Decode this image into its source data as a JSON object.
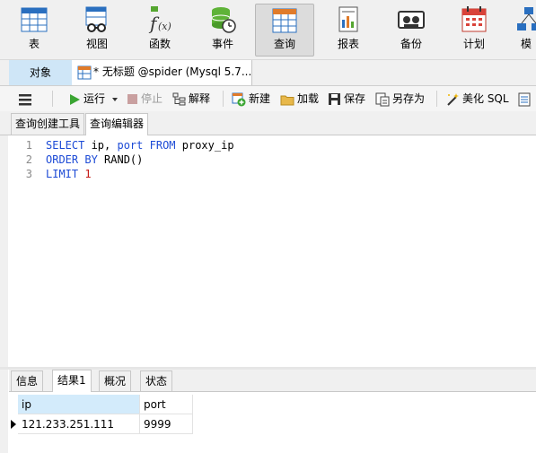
{
  "toolbar": {
    "items": [
      {
        "label": "表",
        "icon": "table-icon"
      },
      {
        "label": "视图",
        "icon": "view-icon"
      },
      {
        "label": "函数",
        "icon": "function-icon"
      },
      {
        "label": "事件",
        "icon": "event-icon"
      },
      {
        "label": "查询",
        "icon": "query-icon",
        "active": true
      },
      {
        "label": "报表",
        "icon": "report-icon"
      },
      {
        "label": "备份",
        "icon": "backup-icon"
      },
      {
        "label": "计划",
        "icon": "schedule-icon"
      },
      {
        "label": "模",
        "icon": "model-icon"
      }
    ]
  },
  "tabs": {
    "objects": "对象",
    "query_tab": "* 无标题 @spider (Mysql 5.7..."
  },
  "editor_toolbar": {
    "menu_icon": "hamburger-menu-icon",
    "run": "运行",
    "stop": "停止",
    "explain": "解释",
    "new": "新建",
    "load": "加载",
    "save": "保存",
    "save_as": "另存为",
    "beautify": "美化 SQL"
  },
  "subtabs": {
    "builder": "查询创建工具",
    "editor": "查询编辑器"
  },
  "sql": {
    "line1": {
      "no": "1",
      "select": "SELECT",
      "ip": " ip, ",
      "port": "port",
      "from": " FROM",
      "table": " proxy_ip"
    },
    "line2": {
      "no": "2",
      "order": "ORDER",
      "by": " BY",
      "rand": " RAND()"
    },
    "line3": {
      "no": "3",
      "limit": "LIMIT",
      "n": " 1"
    }
  },
  "result_tabs": {
    "info": "信息",
    "result1": "结果1",
    "overview": "概况",
    "status": "状态"
  },
  "result": {
    "columns": [
      "ip",
      "port"
    ],
    "rows": [
      [
        "121.233.251.111",
        "9999"
      ]
    ]
  },
  "colors": {
    "keyword": "#1d4bd6",
    "number": "#c41a16",
    "selected_tab": "#cfe6f7"
  }
}
